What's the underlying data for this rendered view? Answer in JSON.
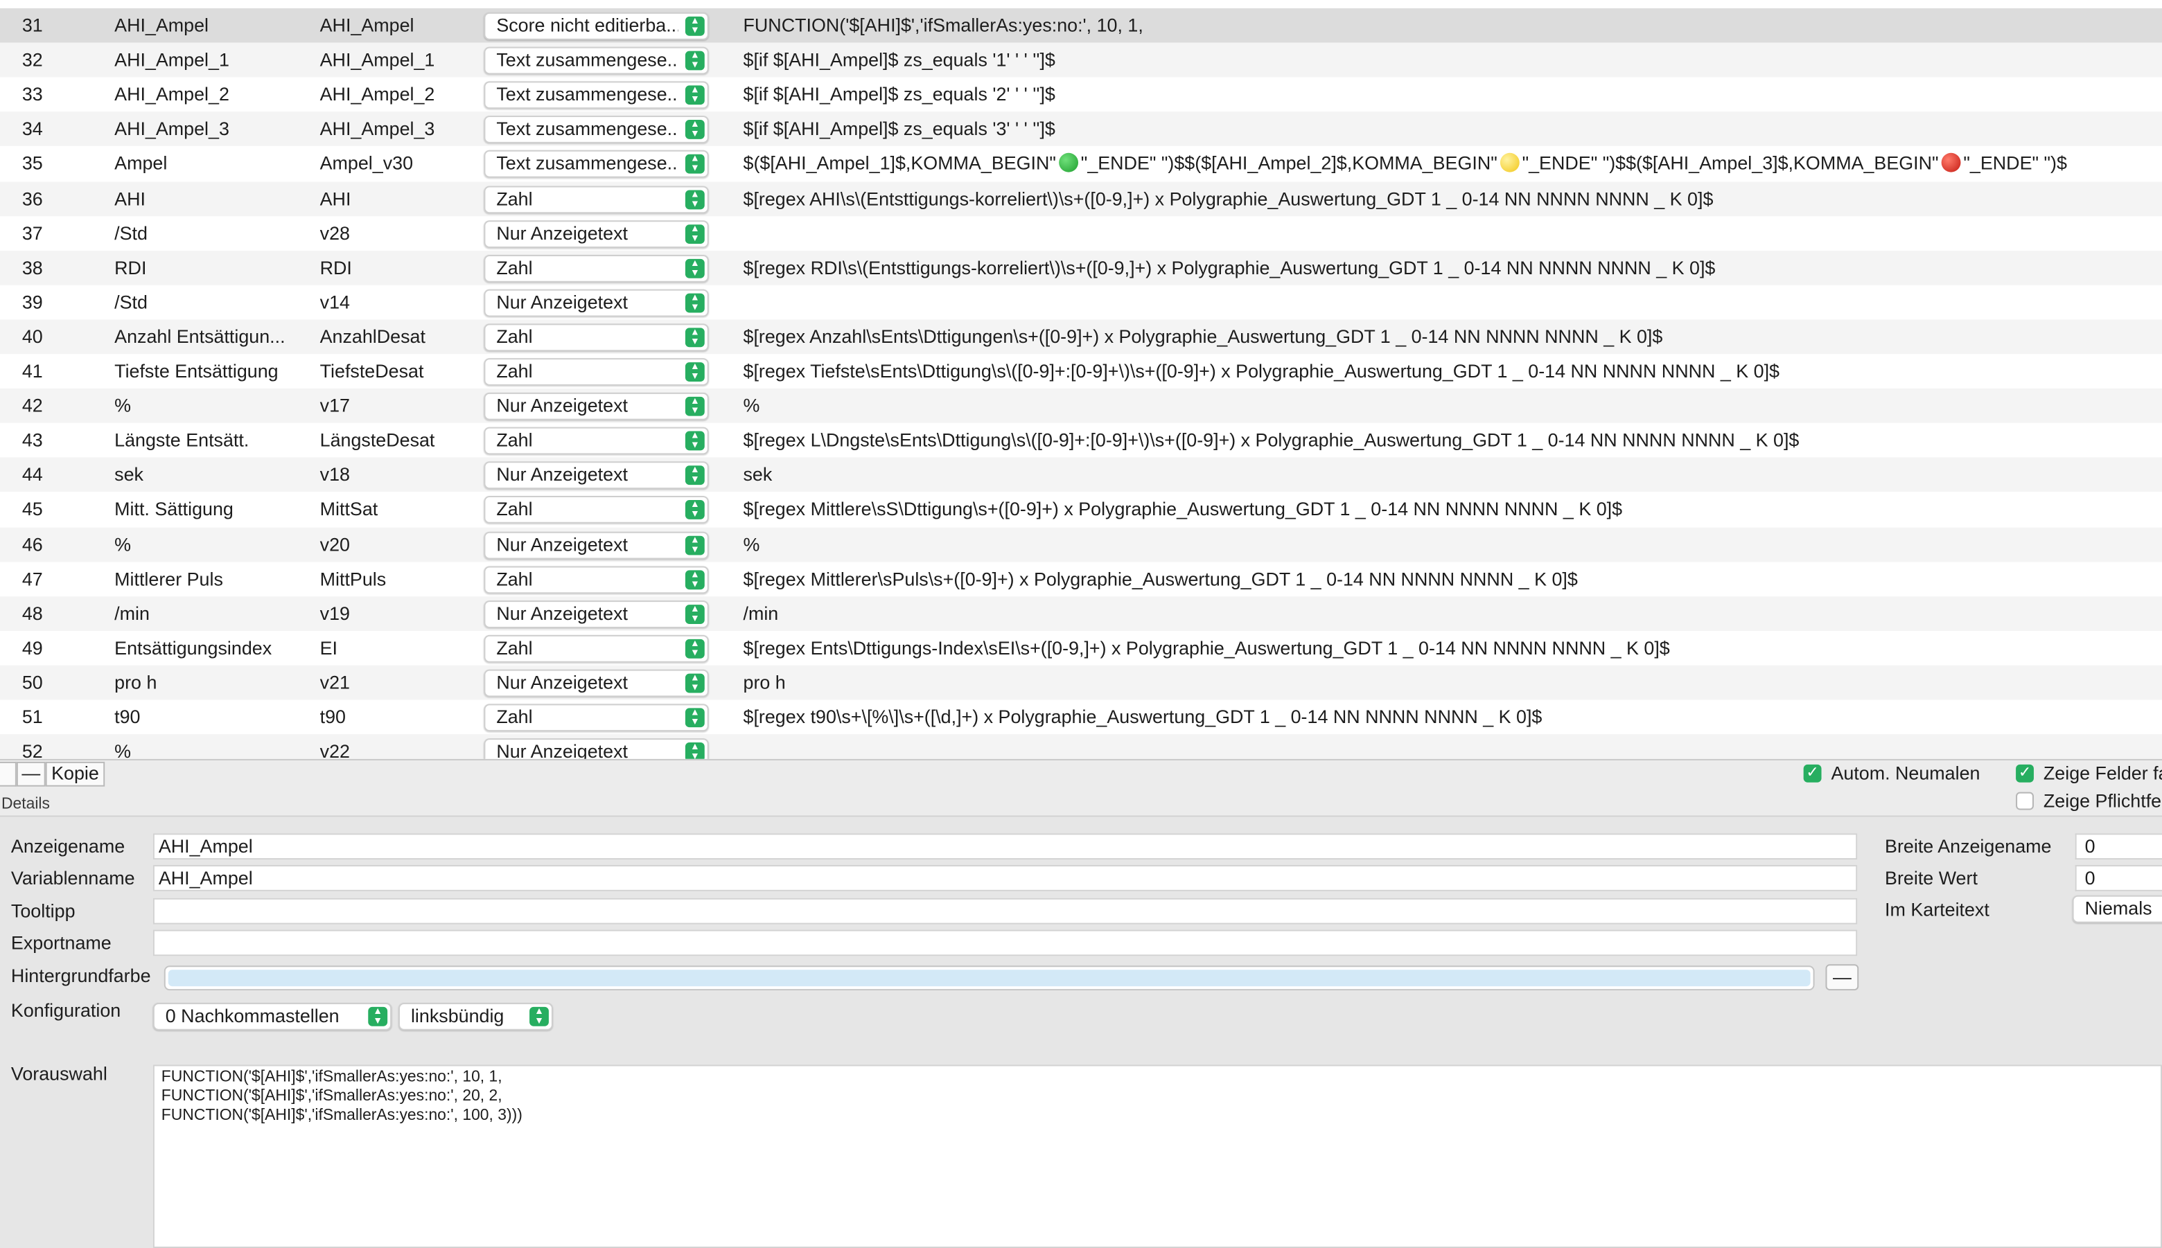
{
  "table": {
    "rows": [
      {
        "num": "31",
        "name": "AHI_Ampel",
        "var": "AHI_Ampel",
        "type": "Score nicht editierba...",
        "formula": "FUNCTION('$[AHI]$','ifSmallerAs:yes:no:', 10, 1,",
        "selected": true
      },
      {
        "num": "32",
        "name": "AHI_Ampel_1",
        "var": "AHI_Ampel_1",
        "type": "Text zusammengese...",
        "formula": "$[if $[AHI_Ampel]$ zs_equals '1' ' ' '']$"
      },
      {
        "num": "33",
        "name": "AHI_Ampel_2",
        "var": "AHI_Ampel_2",
        "type": "Text zusammengese...",
        "formula": "$[if $[AHI_Ampel]$ zs_equals '2' ' ' '']$"
      },
      {
        "num": "34",
        "name": "AHI_Ampel_3",
        "var": "AHI_Ampel_3",
        "type": "Text zusammengese...",
        "formula": "$[if $[AHI_Ampel]$ zs_equals '3' ' ' '']$"
      },
      {
        "num": "35",
        "name": "Ampel",
        "var": "Ampel_v30",
        "type": "Text zusammengese...",
        "formula_parts": [
          {
            "text": "$($[AHI_Ampel_1]$,KOMMA_BEGIN\""
          },
          {
            "dot": "green"
          },
          {
            "text": "\"_ENDE\" \")$$($[AHI_Ampel_2]$,KOMMA_BEGIN\""
          },
          {
            "dot": "yellow"
          },
          {
            "text": "\"_ENDE\" \")$$($[AHI_Ampel_3]$,KOMMA_BEGIN\""
          },
          {
            "dot": "red"
          },
          {
            "text": "\"_ENDE\" \")$"
          }
        ]
      },
      {
        "num": "36",
        "name": "AHI",
        "var": "AHI",
        "type": "Zahl",
        "formula": "$[regex AHI\\s\\(Entsttigungs-korreliert\\)\\s+([0-9,]+) x Polygraphie_Auswertung_GDT 1 _ 0-14 NN NNNN NNNN _ K 0]$"
      },
      {
        "num": "37",
        "name": "/Std",
        "var": "v28",
        "type": "Nur Anzeigetext",
        "formula": ""
      },
      {
        "num": "38",
        "name": "RDI",
        "var": "RDI",
        "type": "Zahl",
        "formula": "$[regex RDI\\s\\(Entsttigungs-korreliert\\)\\s+([0-9,]+) x Polygraphie_Auswertung_GDT 1 _ 0-14 NN NNNN NNNN _ K 0]$"
      },
      {
        "num": "39",
        "name": "/Std",
        "var": "v14",
        "type": "Nur Anzeigetext",
        "formula": ""
      },
      {
        "num": "40",
        "name": "Anzahl Entsättigun...",
        "var": "AnzahlDesat",
        "type": "Zahl",
        "formula": "$[regex Anzahl\\sEnts\\Dttigungen\\s+([0-9]+) x Polygraphie_Auswertung_GDT 1 _ 0-14 NN NNNN NNNN _ K 0]$"
      },
      {
        "num": "41",
        "name": "Tiefste Entsättigung",
        "var": "TiefsteDesat",
        "type": "Zahl",
        "formula": "$[regex Tiefste\\sEnts\\Dttigung\\s\\([0-9]+:[0-9]+\\)\\s+([0-9]+) x Polygraphie_Auswertung_GDT 1 _ 0-14 NN NNNN NNNN _ K 0]$"
      },
      {
        "num": "42",
        "name": "%",
        "var": "v17",
        "type": "Nur Anzeigetext",
        "formula": "%"
      },
      {
        "num": "43",
        "name": "Längste Entsätt.",
        "var": "LängsteDesat",
        "type": "Zahl",
        "formula": "$[regex L\\Dngste\\sEnts\\Dttigung\\s\\([0-9]+:[0-9]+\\)\\s+([0-9]+) x Polygraphie_Auswertung_GDT 1 _ 0-14 NN NNNN NNNN _ K 0]$"
      },
      {
        "num": "44",
        "name": "sek",
        "var": "v18",
        "type": "Nur Anzeigetext",
        "formula": "sek"
      },
      {
        "num": "45",
        "name": "Mitt. Sättigung",
        "var": "MittSat",
        "type": "Zahl",
        "formula": "$[regex Mittlere\\sS\\Dttigung\\s+([0-9]+) x Polygraphie_Auswertung_GDT 1 _ 0-14 NN NNNN NNNN _ K 0]$"
      },
      {
        "num": "46",
        "name": "%",
        "var": "v20",
        "type": "Nur Anzeigetext",
        "formula": "%"
      },
      {
        "num": "47",
        "name": "Mittlerer Puls",
        "var": "MittPuls",
        "type": "Zahl",
        "formula": "$[regex Mittlerer\\sPuls\\s+([0-9]+) x Polygraphie_Auswertung_GDT 1 _ 0-14 NN NNNN NNNN _ K 0]$"
      },
      {
        "num": "48",
        "name": "/min",
        "var": "v19",
        "type": "Nur Anzeigetext",
        "formula": "/min"
      },
      {
        "num": "49",
        "name": "Entsättigungsindex",
        "var": "EI",
        "type": "Zahl",
        "formula": "$[regex Ents\\Dttigungs-Index\\sEI\\s+([0-9,]+) x Polygraphie_Auswertung_GDT 1 _ 0-14 NN NNNN NNNN _ K 0]$"
      },
      {
        "num": "50",
        "name": "pro h",
        "var": "v21",
        "type": "Nur Anzeigetext",
        "formula": "pro h"
      },
      {
        "num": "51",
        "name": "t90",
        "var": "t90",
        "type": "Zahl",
        "formula": "$[regex t90\\s+\\[%\\]\\s+([\\d,]+) x Polygraphie_Auswertung_GDT 1 _ 0-14 NN NNNN NNNN _ K 0]$"
      },
      {
        "num": "52",
        "name": "%",
        "var": "v22",
        "type": "Nur Anzeigetext",
        "formula": ""
      }
    ]
  },
  "toolbar": {
    "remove_label": "—",
    "copy_label": "Kopie",
    "auto_rename_label": "Autom. Neumalen",
    "auto_rename_checked": true,
    "show_fields_label": "Zeige Felder fa",
    "show_fields_checked": true,
    "show_required_label": "Zeige Pflichtfe",
    "show_required_checked": false
  },
  "details": {
    "section_label": "Details",
    "display_name_label": "Anzeigename",
    "display_name_value": "AHI_Ampel",
    "variable_name_label": "Variablenname",
    "variable_name_value": "AHI_Ampel",
    "tooltip_label": "Tooltipp",
    "tooltip_value": "",
    "export_name_label": "Exportname",
    "export_name_value": "",
    "background_color_label": "Hintergrundfarbe",
    "background_color": "#d3e9f7",
    "clear_color_label": "—",
    "config_label": "Konfiguration",
    "decimals_value": "0 Nachkommastellen",
    "alignment_value": "linksbündig",
    "preselection_label": "Vorauswahl",
    "preselection_lines": [
      "FUNCTION('$[AHI]$','ifSmallerAs:yes:no:', 10, 1,",
      "FUNCTION('$[AHI]$','ifSmallerAs:yes:no:', 20, 2,",
      "FUNCTION('$[AHI]$','ifSmallerAs:yes:no:', 100, 3)))"
    ],
    "width_display_label": "Breite Anzeigename",
    "width_display_value": "0",
    "width_value_label": "Breite Wert",
    "width_value_value": "0",
    "in_card_text_label": "Im Karteitext",
    "in_card_text_value": "Niemals"
  },
  "colors": {
    "accent": "#27ae60",
    "selected_row": "#dcdcdc",
    "alt_row": "#f4f4f4"
  }
}
